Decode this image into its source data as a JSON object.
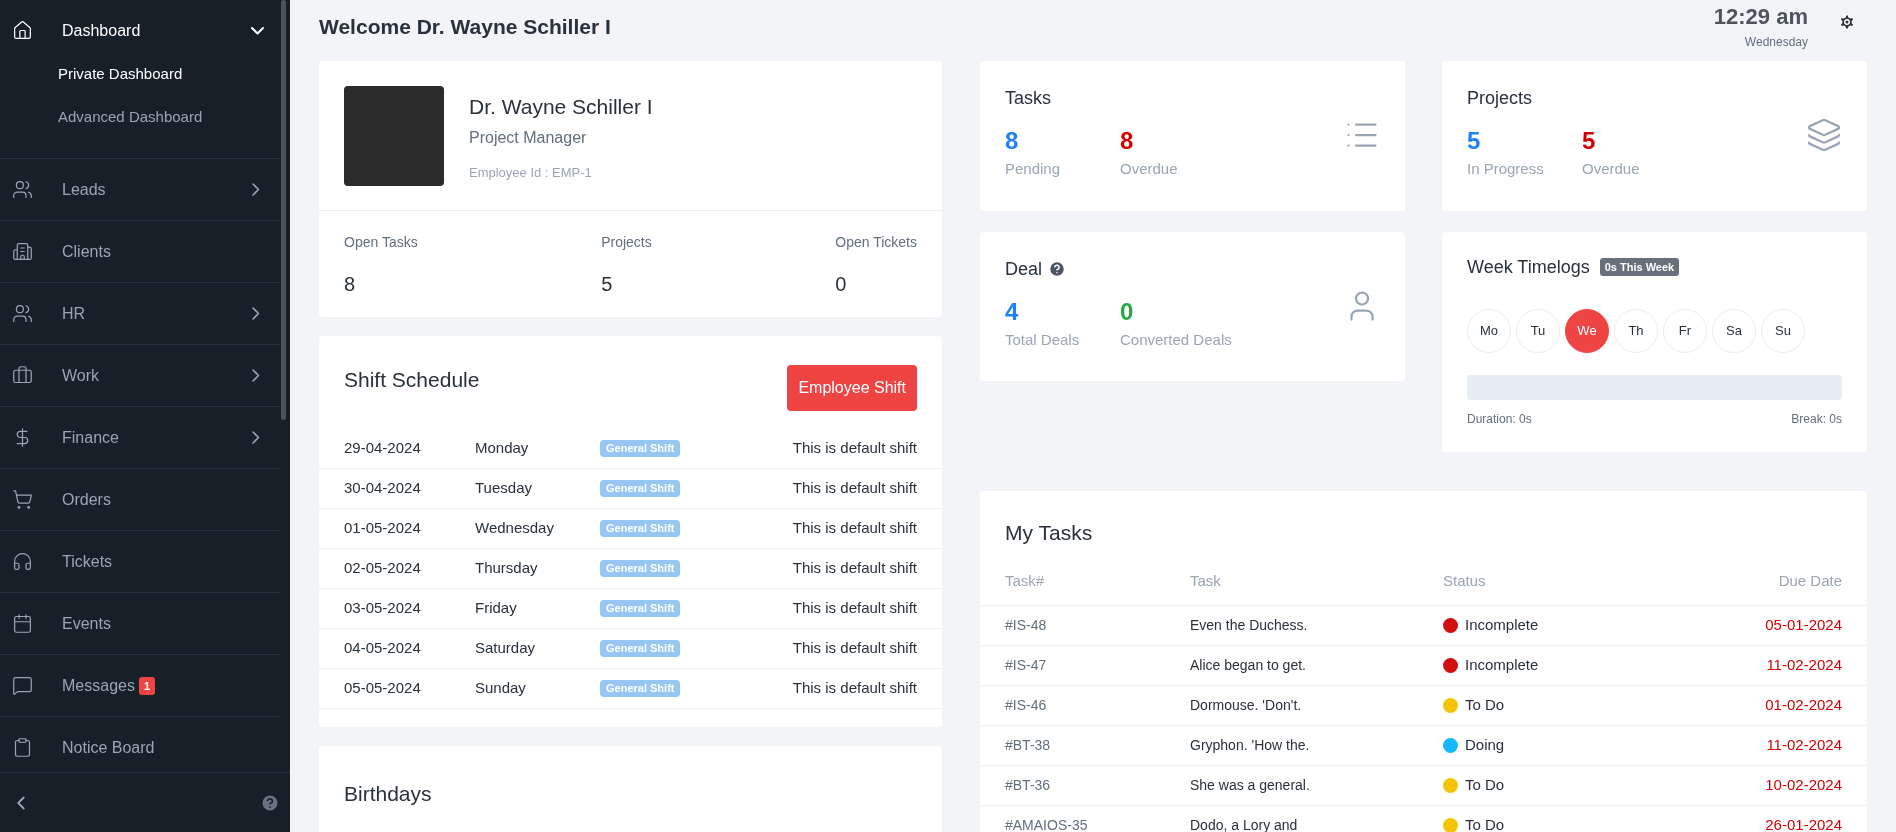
{
  "sidebar": {
    "items": [
      {
        "label": "Dashboard",
        "kind": "group",
        "expanded": true,
        "children": [
          {
            "label": "Private Dashboard",
            "selected": true
          },
          {
            "label": "Advanced Dashboard",
            "selected": false
          }
        ]
      },
      {
        "label": "Leads",
        "kind": "group",
        "expanded": false
      },
      {
        "label": "Clients",
        "kind": "link"
      },
      {
        "label": "HR",
        "kind": "group",
        "expanded": false
      },
      {
        "label": "Work",
        "kind": "group",
        "expanded": false
      },
      {
        "label": "Finance",
        "kind": "group",
        "expanded": false
      },
      {
        "label": "Orders",
        "kind": "link"
      },
      {
        "label": "Tickets",
        "kind": "link"
      },
      {
        "label": "Events",
        "kind": "link"
      },
      {
        "label": "Messages",
        "kind": "link",
        "badge": "1"
      },
      {
        "label": "Notice Board",
        "kind": "link"
      }
    ]
  },
  "header": {
    "title": "Welcome Dr. Wayne Schiller I",
    "time": "12:29 am",
    "day": "Wednesday"
  },
  "profile": {
    "name": "Dr. Wayne Schiller I",
    "role": "Project Manager",
    "employee_id": "Employee Id : EMP-1",
    "stats": [
      {
        "label": "Open Tasks",
        "value": "8"
      },
      {
        "label": "Projects",
        "value": "5"
      },
      {
        "label": "Open Tickets",
        "value": "0"
      }
    ]
  },
  "shift_schedule": {
    "title": "Shift Schedule",
    "button": "Employee Shift",
    "rows": [
      {
        "date": "29-04-2024",
        "day": "Monday",
        "shift": "General Shift",
        "note": "This is default shift"
      },
      {
        "date": "30-04-2024",
        "day": "Tuesday",
        "shift": "General Shift",
        "note": "This is default shift"
      },
      {
        "date": "01-05-2024",
        "day": "Wednesday",
        "shift": "General Shift",
        "note": "This is default shift"
      },
      {
        "date": "02-05-2024",
        "day": "Thursday",
        "shift": "General Shift",
        "note": "This is default shift"
      },
      {
        "date": "03-05-2024",
        "day": "Friday",
        "shift": "General Shift",
        "note": "This is default shift"
      },
      {
        "date": "04-05-2024",
        "day": "Saturday",
        "shift": "General Shift",
        "note": "This is default shift"
      },
      {
        "date": "05-05-2024",
        "day": "Sunday",
        "shift": "General Shift",
        "note": "This is default shift"
      }
    ]
  },
  "birthdays": {
    "title": "Birthdays"
  },
  "tasks": {
    "title": "Tasks",
    "stats": [
      {
        "value": "8",
        "label": "Pending",
        "kind": "pending"
      },
      {
        "value": "8",
        "label": "Overdue",
        "kind": "overdue"
      }
    ]
  },
  "projects": {
    "title": "Projects",
    "stats": [
      {
        "value": "5",
        "label": "In Progress",
        "kind": "pending"
      },
      {
        "value": "5",
        "label": "Overdue",
        "kind": "overdue"
      }
    ]
  },
  "deal": {
    "title": "Deal",
    "stats": [
      {
        "value": "4",
        "label": "Total Deals",
        "kind": "pending"
      },
      {
        "value": "0",
        "label": "Converted Deals",
        "kind": "converted"
      }
    ]
  },
  "week_timelogs": {
    "title": "Week Timelogs",
    "badge": "0s This Week",
    "days": [
      {
        "label": "Mo",
        "selected": false
      },
      {
        "label": "Tu",
        "selected": false
      },
      {
        "label": "We",
        "selected": true
      },
      {
        "label": "Th",
        "selected": false
      },
      {
        "label": "Fr",
        "selected": false
      },
      {
        "label": "Sa",
        "selected": false
      },
      {
        "label": "Su",
        "selected": false
      }
    ],
    "duration": "Duration: 0s",
    "break": "Break: 0s"
  },
  "my_tasks": {
    "title": "My Tasks",
    "columns": [
      "Task#",
      "Task",
      "Status",
      "Due Date"
    ],
    "rows": [
      {
        "id": "#IS-48",
        "task": "Even the Duchess.",
        "status": "Incomplete",
        "color": "#d21010",
        "due": "05-01-2024"
      },
      {
        "id": "#IS-47",
        "task": "Alice began to get.",
        "status": "Incomplete",
        "color": "#d21010",
        "due": "11-02-2024"
      },
      {
        "id": "#IS-46",
        "task": "Dormouse. 'Don't.",
        "status": "To Do",
        "color": "#f5c308",
        "due": "01-02-2024"
      },
      {
        "id": "#BT-38",
        "task": "Gryphon. 'How the.",
        "status": "Doing",
        "color": "#16b9ff",
        "due": "11-02-2024"
      },
      {
        "id": "#BT-36",
        "task": "She was a general.",
        "status": "To Do",
        "color": "#f5c308",
        "due": "10-02-2024"
      },
      {
        "id": "#AMAIOS-35",
        "task": "Dodo, a Lory and",
        "status": "To Do",
        "color": "#f5c308",
        "due": "26-01-2024"
      }
    ]
  }
}
